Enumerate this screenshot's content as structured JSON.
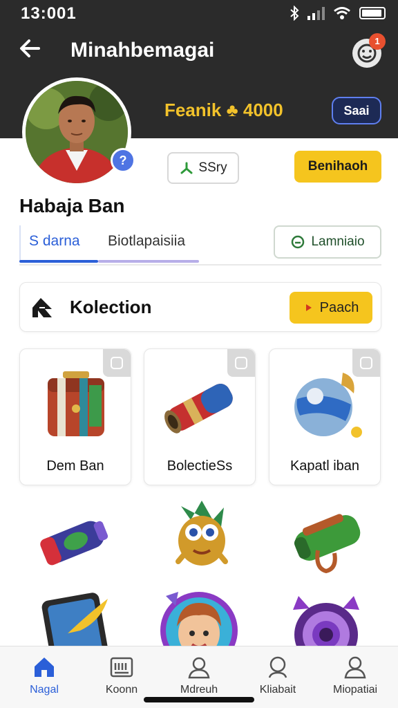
{
  "status_bar": {
    "time": "13:001",
    "icons": [
      "bluetooth-icon",
      "signal-icon",
      "wifi-icon",
      "battery-icon"
    ]
  },
  "header": {
    "title": "Minahbemagai",
    "back_icon": "arrow-left-icon",
    "profile_icon": "smiley-icon",
    "notification_count": "1",
    "coins_text": "Feanik ♣ 4000",
    "header_button": "Saai",
    "colors": {
      "background": "#2b2b2b",
      "accent": "#f2c22b",
      "button_border": "#5f7ff0"
    }
  },
  "profile": {
    "verify_symbol": "?",
    "stat_chip": "SSry",
    "action_button": "Benihaoh",
    "username": "Habaja Ban"
  },
  "tabs": {
    "items": [
      {
        "label": "S darna"
      },
      {
        "label": "Biotlapaisiia"
      }
    ],
    "outline_button": "Lamniaio"
  },
  "collection": {
    "title": "Kolection",
    "button": "Paach"
  },
  "items": [
    {
      "name": "Dem Ban",
      "icon": "treasure-chest-icon"
    },
    {
      "name": "BolectieSs",
      "icon": "cannon-icon"
    },
    {
      "name": "Kapatl iban",
      "icon": "orb-icon"
    }
  ],
  "extra_items": [
    {
      "icon": "bottle-icon"
    },
    {
      "icon": "creature-icon"
    },
    {
      "icon": "green-bracelet-icon"
    },
    {
      "icon": "mirror-icon"
    },
    {
      "icon": "character-portrait-icon"
    },
    {
      "icon": "purple-gear-icon"
    }
  ],
  "bottom_nav": {
    "items": [
      {
        "label": "Nagal",
        "icon": "home-icon",
        "active": true
      },
      {
        "label": "Koonn",
        "icon": "keyboard-icon",
        "active": false
      },
      {
        "label": "Mdreuh",
        "icon": "person-icon",
        "active": false
      },
      {
        "label": "Kliabait",
        "icon": "search-person-icon",
        "active": false
      },
      {
        "label": "Miopatiai",
        "icon": "profile-icon",
        "active": false
      }
    ]
  }
}
